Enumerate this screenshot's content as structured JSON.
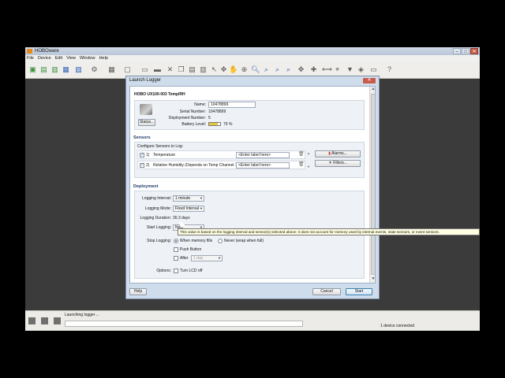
{
  "window": {
    "title": "HOBOware",
    "minimize": "–",
    "maximize": "□",
    "close": "✕"
  },
  "menu": [
    "File",
    "Device",
    "Edit",
    "View",
    "Window",
    "Help"
  ],
  "toolbar_icons": [
    "launch-icon",
    "readout-icon",
    "readout-stop-icon",
    "status-icon",
    "preferences-icon",
    "options-icon",
    "grid-icon",
    "frame-icon",
    "open-icon",
    "delete-icon",
    "copy-icon",
    "paste-icon",
    "print-icon",
    "pointer-icon",
    "hand-icon",
    "zoom-icon",
    "zoom-in-icon",
    "zoom-out-icon",
    "select-zoom-icon",
    "fit-icon",
    "move-icon",
    "filter-icon",
    "tag-icon",
    "help-icon"
  ],
  "dialog": {
    "title": "Launch Logger",
    "close": "✕",
    "device_header": "HOBO UX100-003 Temp/RH",
    "status_button": "Status...",
    "fields": {
      "name_label": "Name:",
      "name_value": "10478899",
      "serial_label": "Serial Number:",
      "serial_value": "10478899",
      "deployment_label": "Deployment Number:",
      "deployment_value": "5",
      "battery_label": "Battery Level:",
      "battery_value": "79 %",
      "battery_level": 0.79
    },
    "sensors": {
      "header": "Sensors",
      "configure_label": "Configure Sensors to Log:",
      "rows": [
        {
          "checked": true,
          "index": "1)",
          "name": "Temperature",
          "placeholder": "<Enter label here>"
        },
        {
          "checked": true,
          "index": "2)",
          "name": "Relative Humidity (Depends on Temp Channel 1)",
          "placeholder": "<Enter label here>"
        }
      ],
      "alarms_button": "Alarms...",
      "filters_button": "Filters..."
    },
    "deployment": {
      "header": "Deployment",
      "logging_interval_label": "Logging Interval:",
      "logging_interval_value": "1 minute",
      "logging_mode_label": "Logging Mode:",
      "logging_mode_value": "Fixed Interval",
      "logging_duration_label": "Logging Duration:",
      "logging_duration_value": "30.3 days",
      "start_logging_label": "Start Logging:",
      "start_logging_value": "Now",
      "stop_logging_label": "Stop Logging:",
      "stop_when_memory_fills": "When memory fills",
      "stop_never": "Never (wrap when full)",
      "push_button": "Push Button",
      "after_label": "After",
      "after_value": "1 day",
      "options_label": "Options:",
      "turn_lcd_off": "Turn LCD off"
    },
    "help_button": "Help",
    "cancel_button": "Cancel",
    "start_button": "Start"
  },
  "tooltip": "This value is based on the logging interval and sensor(s) selected above; it does not account for memory used by internal events, state sensors, or event sensors.",
  "status": {
    "left": "Launching logger ...",
    "right": "1 device connected",
    "progress": 0
  },
  "colors": {
    "section_header": "#24406b",
    "titlebar": "#b8c6d8",
    "workspace": "#3b3b3b"
  }
}
